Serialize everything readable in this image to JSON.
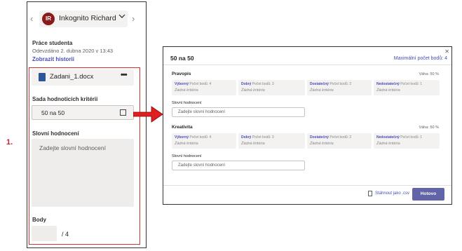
{
  "left_panel": {
    "student_initials": "IR",
    "student_name": "Inkognito Richard",
    "student_work_title": "Práce studenta",
    "submitted_text": "Odevzdáno 2. dubna 2020 v 13:43",
    "show_history_link": "Zobrazit historii",
    "file_name": "Zadani_1.docx",
    "rubric_title": "Sada hodnoticích kritérii",
    "rubric_value": "50 na 50",
    "feedback_title": "Slovní hodnocení",
    "feedback_placeholder": "Zadejte slovní hodnocení",
    "points_title": "Body",
    "points_value": "",
    "points_max": "/ 4"
  },
  "step_label": "1.",
  "dialog": {
    "title": "50 na 50",
    "max_points": "Maximální počet bodů: 4",
    "criteria": [
      {
        "name": "Pravopis",
        "weight": "Váha: 50 %",
        "levels": [
          {
            "name": "Výborný",
            "points": "Počet bodů: 4",
            "desc": "Žádná kritéria"
          },
          {
            "name": "Dobrý",
            "points": "Počet bodů: 3",
            "desc": "Žádná kritéria"
          },
          {
            "name": "Dostatečný",
            "points": "Počet bodů: 2",
            "desc": "Žádná kritéria"
          },
          {
            "name": "Nedostatečný",
            "points": "Počet bodů: 1",
            "desc": "Žádná kritéria"
          }
        ],
        "feedback_label": "Slovní hodnocení",
        "feedback_placeholder": "Zadejte slovní hodnocení"
      },
      {
        "name": "Kreativita",
        "weight": "Váha: 50 %",
        "levels": [
          {
            "name": "Výborný",
            "points": "Počet bodů: 4",
            "desc": "Žádná kritéria"
          },
          {
            "name": "Dobrý",
            "points": "Počet bodů: 3",
            "desc": "Žádná kritéria"
          },
          {
            "name": "Dostatečný",
            "points": "Počet bodů: 2",
            "desc": "Žádná kritéria"
          },
          {
            "name": "Nedostatečný",
            "points": "Počet bodů: 1",
            "desc": "Žádná kritéria"
          }
        ],
        "feedback_label": "Slovní hodnocení",
        "feedback_placeholder": "Zadejte slovní hodnocení"
      }
    ],
    "download_label": "Stáhnout jako .csv",
    "done_label": "Hotovo"
  },
  "colors": {
    "accent": "#6264a7",
    "link": "#464eb8",
    "highlight_red": "#d9302c"
  },
  "icons": [
    "chevron-left-icon",
    "chevron-right-icon",
    "chevron-down-icon",
    "word-file-icon",
    "more-icon",
    "open-rubric-icon",
    "close-icon",
    "download-icon",
    "arrow-icon"
  ]
}
